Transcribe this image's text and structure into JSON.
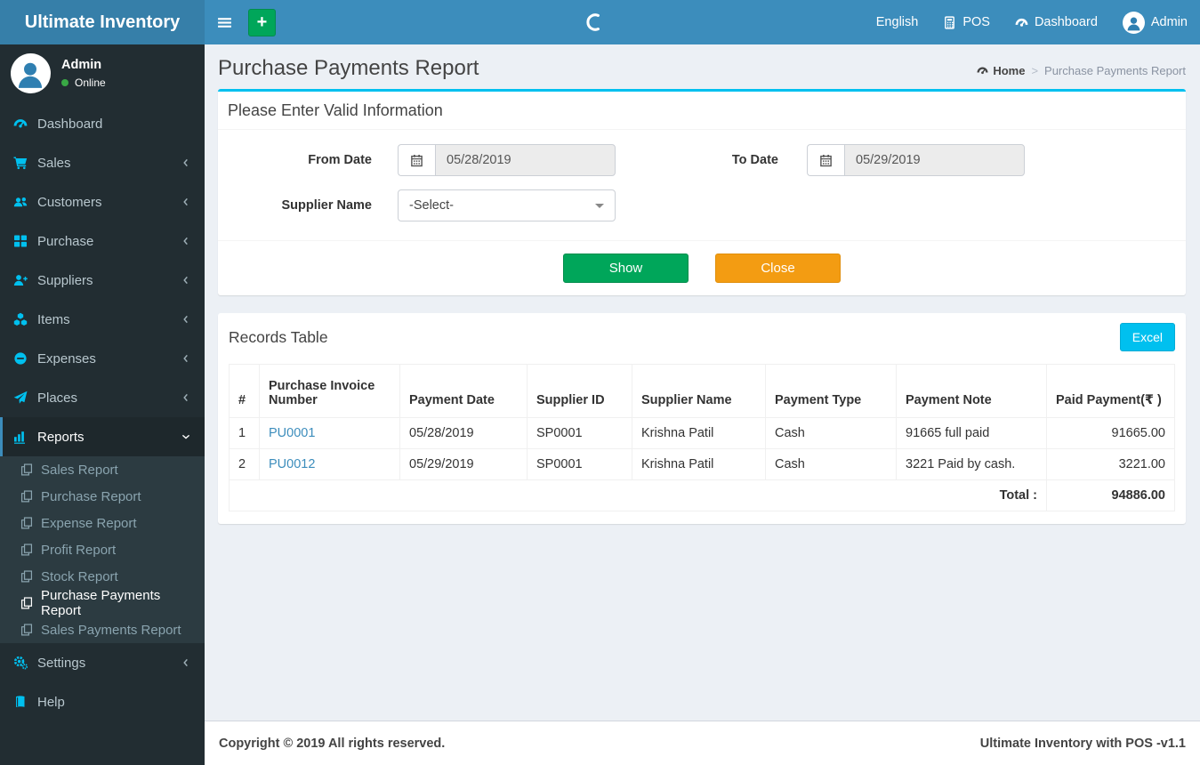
{
  "navbar": {
    "brand": "Ultimate Inventory",
    "add_button_label": "+",
    "items": [
      {
        "label": "English",
        "icon": "none"
      },
      {
        "label": "POS",
        "icon": "calculator-icon"
      },
      {
        "label": "Dashboard",
        "icon": "tachometer-icon"
      },
      {
        "label": "Admin",
        "icon": "user-avatar-icon"
      }
    ]
  },
  "sidebar": {
    "user": {
      "name": "Admin",
      "status": "Online"
    },
    "items": [
      {
        "label": "Dashboard",
        "icon": "tachometer-icon"
      },
      {
        "label": "Sales",
        "icon": "cart-icon"
      },
      {
        "label": "Customers",
        "icon": "users-icon"
      },
      {
        "label": "Purchase",
        "icon": "grid-icon"
      },
      {
        "label": "Suppliers",
        "icon": "user-plus-icon"
      },
      {
        "label": "Items",
        "icon": "cubes-icon"
      },
      {
        "label": "Expenses",
        "icon": "minus-circle-icon"
      },
      {
        "label": "Places",
        "icon": "paper-plane-icon"
      },
      {
        "label": "Reports",
        "icon": "bar-chart-icon"
      }
    ],
    "report_submenu": [
      "Sales Report",
      "Purchase Report",
      "Expense Report",
      "Profit Report",
      "Stock Report",
      "Purchase Payments Report",
      "Sales Payments Report"
    ],
    "active_item": "Reports",
    "active_submenu": "Purchase Payments Report",
    "items_bottom": [
      {
        "label": "Settings",
        "icon": "gears-icon"
      },
      {
        "label": "Help",
        "icon": "book-icon"
      }
    ]
  },
  "page": {
    "title": "Purchase Payments Report",
    "breadcrumb": {
      "home": "Home",
      "separator": ">",
      "current": "Purchase Payments Report"
    }
  },
  "filter": {
    "title": "Please Enter Valid Information",
    "from_date": {
      "label": "From Date",
      "value": "05/28/2019"
    },
    "to_date": {
      "label": "To Date",
      "value": "05/29/2019"
    },
    "supplier": {
      "label": "Supplier Name",
      "value": "-Select-"
    },
    "show_button": "Show",
    "close_button": "Close"
  },
  "records": {
    "title": "Records Table",
    "excel_button": "Excel",
    "table": {
      "headers": [
        "#",
        "Purchase Invoice Number",
        "Payment Date",
        "Supplier ID",
        "Supplier Name",
        "Payment Type",
        "Payment Note",
        "Paid Payment(₹ )"
      ],
      "rows": [
        {
          "num": "1",
          "invoice": "PU0001",
          "date": "05/28/2019",
          "supplier_id": "SP0001",
          "supplier_name": "Krishna Patil",
          "type": "Cash",
          "note": "91665 full paid",
          "paid": "91665.00"
        },
        {
          "num": "2",
          "invoice": "PU0012",
          "date": "05/29/2019",
          "supplier_id": "SP0001",
          "supplier_name": "Krishna Patil",
          "type": "Cash",
          "note": "3221 Paid by cash.",
          "paid": "3221.00"
        }
      ],
      "total_label": "Total :",
      "total_value": "94886.00"
    }
  },
  "footer": {
    "left": "Copyright © 2019 All rights reserved.",
    "right": "Ultimate Inventory with POS -v1.1"
  },
  "colors": {
    "navbar_blue": "#3c8dbc",
    "logo_blue": "#367fa9",
    "sidebar_dark": "#222d32",
    "accent_cyan": "#00c0ef",
    "success_green": "#00a65a",
    "warning_orange": "#f39c12",
    "link_blue": "#3c8dbc",
    "online_green": "#39a845"
  }
}
